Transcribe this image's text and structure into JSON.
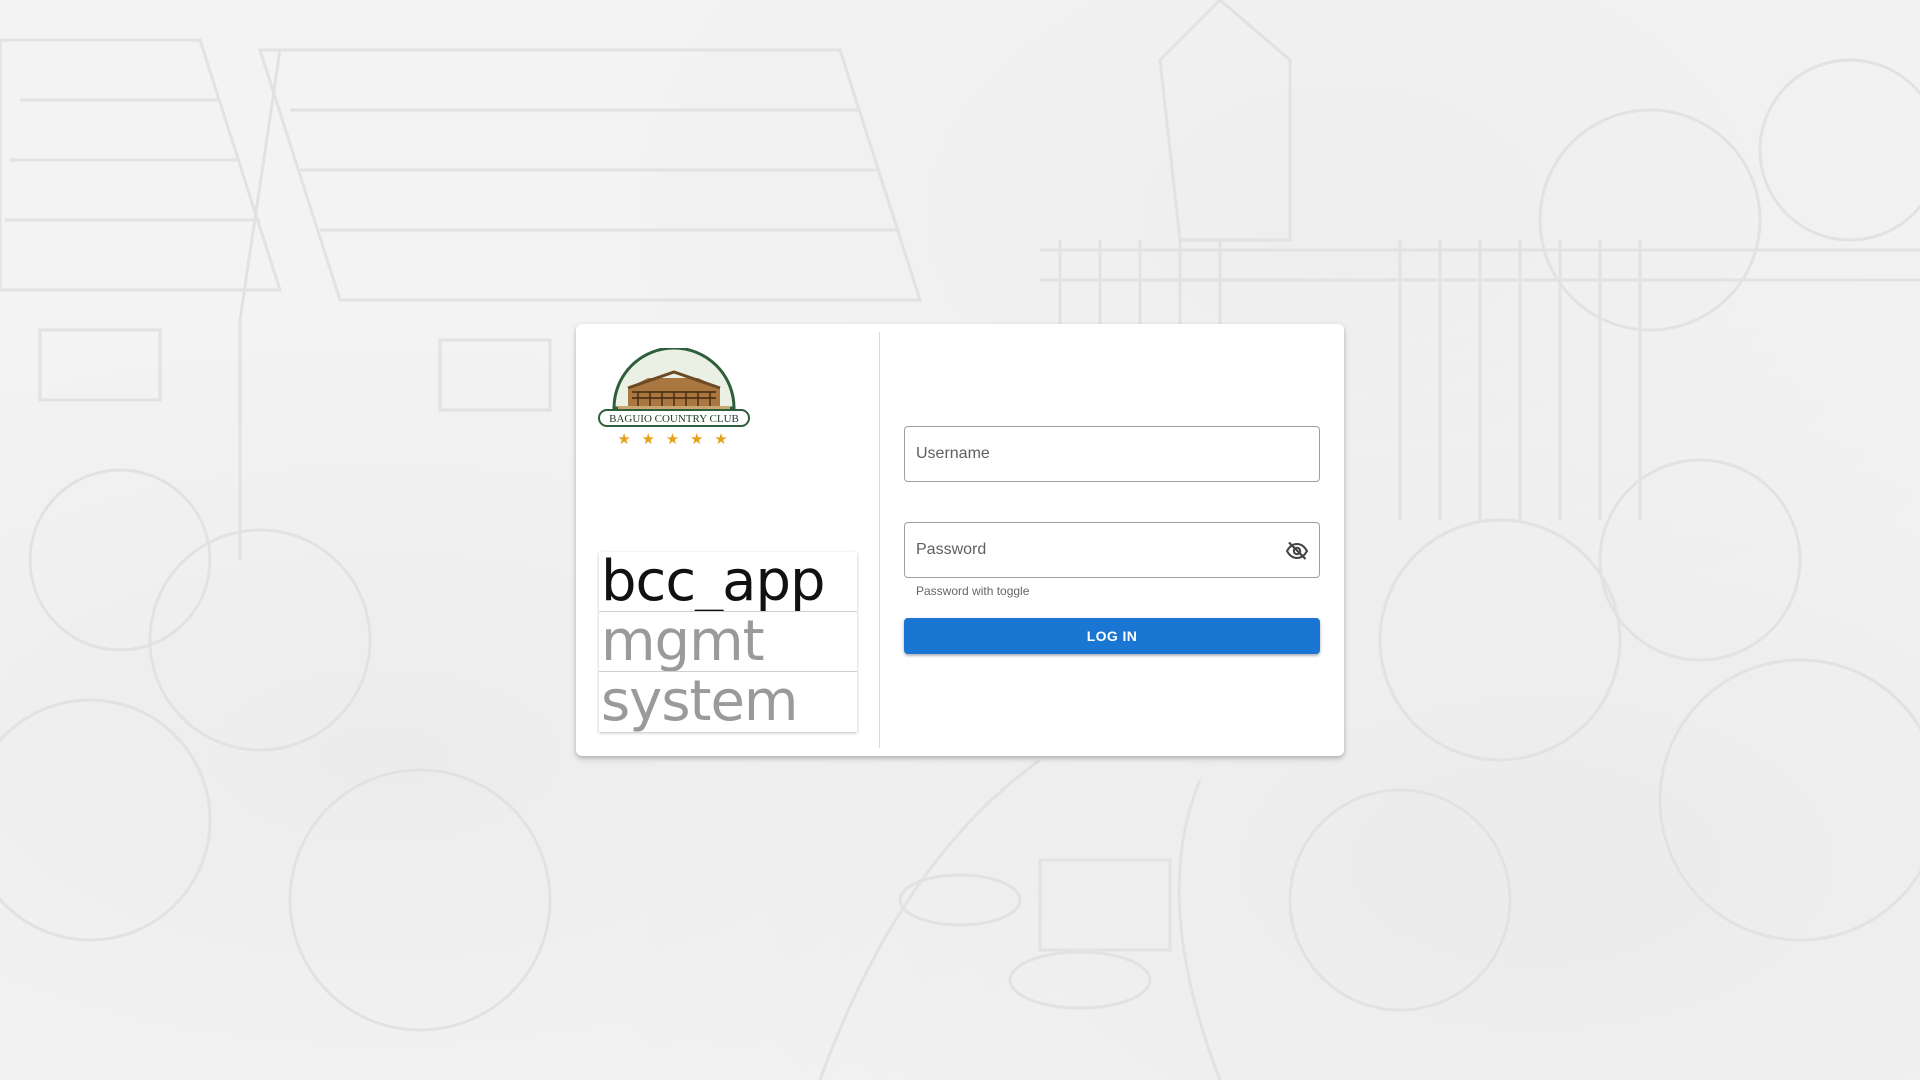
{
  "logo": {
    "text": "BAGUIO COUNTRY CLUB",
    "stars": "★ ★ ★ ★ ★",
    "colors": {
      "ring": "#2e5e3a",
      "star": "#e6a11c",
      "sky": "#eaf0e4"
    }
  },
  "app_title": {
    "line1": "bcc_app",
    "line2": "mgmt",
    "line3": "system"
  },
  "form": {
    "username_placeholder": "Username",
    "password_placeholder": "Password",
    "password_hint": "Password with toggle",
    "toggle_icon": "eye-off-icon",
    "login_label": "LOG IN"
  },
  "colors": {
    "primary": "#1976d2",
    "background": "#f4f4f4"
  }
}
